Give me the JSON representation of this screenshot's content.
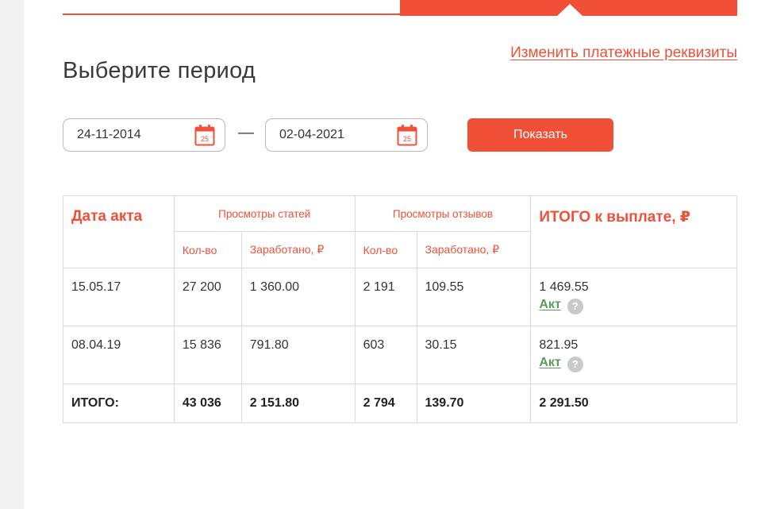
{
  "header": {
    "change_link": "Изменить платежные реквизиты",
    "title": "Выберите период"
  },
  "filters": {
    "date_from": "24-11-2014",
    "date_to": "02-04-2021",
    "calendar_day": "25",
    "separator": "—",
    "show_button": "Показать"
  },
  "table": {
    "col_date": "Дата акта",
    "group_articles": "Просмотры статей",
    "group_reviews": "Просмотры отзывов",
    "col_total": "ИТОГО к выплате, ₽",
    "sub_count": "Кол-во",
    "sub_earned": "Заработано, ₽",
    "rows": [
      {
        "date": "15.05.17",
        "art_count": "27 200",
        "art_earned": "1 360.00",
        "rev_count": "2 191",
        "rev_earned": "109.55",
        "total": "1 469.55",
        "act": "Акт"
      },
      {
        "date": "08.04.19",
        "art_count": "15 836",
        "art_earned": "791.80",
        "rev_count": "603",
        "rev_earned": "30.15",
        "total": "821.95",
        "act": "Акт"
      }
    ],
    "totals": {
      "label": "ИТОГО:",
      "art_count": "43 036",
      "art_earned": "2 151.80",
      "rev_count": "2 794",
      "rev_earned": "139.70",
      "total": "2 291.50"
    },
    "help_glyph": "?"
  },
  "colors": {
    "accent": "#f05038",
    "link_green": "#5a9a5a",
    "border": "#dadada"
  }
}
